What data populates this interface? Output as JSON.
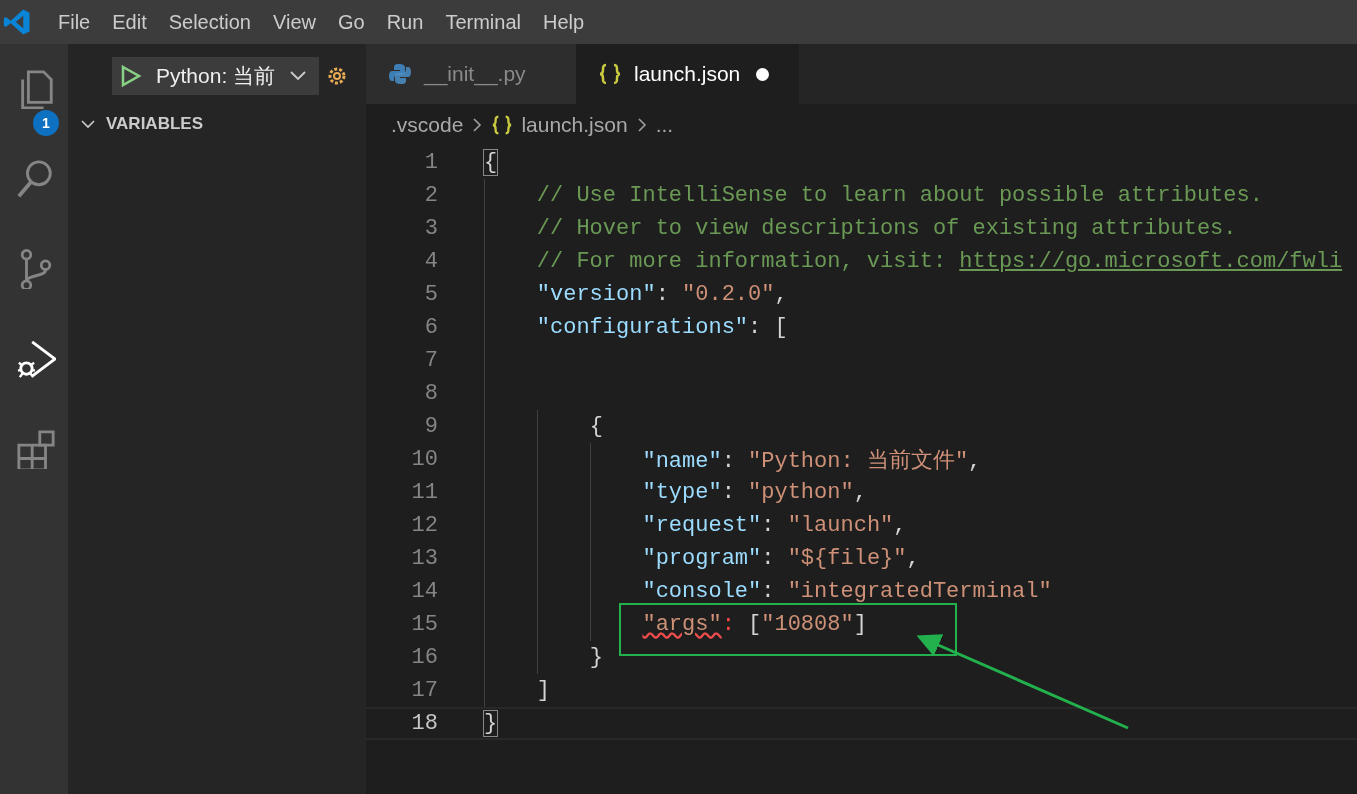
{
  "menu": [
    "File",
    "Edit",
    "Selection",
    "View",
    "Go",
    "Run",
    "Terminal",
    "Help"
  ],
  "activity_bar": [
    {
      "kind": "files",
      "selected": false,
      "badge": "1"
    },
    {
      "kind": "search",
      "selected": false
    },
    {
      "kind": "source-control",
      "selected": false
    },
    {
      "kind": "debug",
      "selected": true
    },
    {
      "kind": "extensions",
      "selected": false
    }
  ],
  "sidebar": {
    "run_config": "Python: 当前",
    "section": {
      "title": "VARIABLES",
      "expanded": true
    }
  },
  "tabs": [
    {
      "label": "__init__.py",
      "kind": "python",
      "selected": false,
      "modified": false
    },
    {
      "label": "launch.json",
      "kind": "json",
      "selected": true,
      "modified": true
    }
  ],
  "breadcrumb": [
    {
      "text": ".vscode",
      "kind": "folder"
    },
    {
      "text": "launch.json",
      "kind": "json"
    },
    {
      "text": "...",
      "kind": "more"
    }
  ],
  "code": [
    {
      "number": "1",
      "selected": false,
      "tokens": [
        {
          "kind": "bracket",
          "text": "{"
        }
      ]
    },
    {
      "number": "2",
      "selected": false,
      "tokens": [
        {
          "kind": "comment",
          "text": "    // Use IntelliSense to learn about possible attributes."
        }
      ]
    },
    {
      "number": "3",
      "selected": false,
      "tokens": [
        {
          "kind": "comment",
          "text": "    // Hover to view descriptions of existing attributes."
        }
      ]
    },
    {
      "number": "4",
      "selected": false,
      "tokens": [
        {
          "kind": "comment",
          "text": "    // For more information, visit: "
        },
        {
          "kind": "link",
          "text": "https://go.microsoft.com/fwli"
        }
      ]
    },
    {
      "number": "5",
      "selected": false,
      "tokens": [
        {
          "kind": "key",
          "text": "    \"version\""
        },
        {
          "kind": "punct",
          "text": ": "
        },
        {
          "kind": "string",
          "text": "\"0.2.0\""
        },
        {
          "kind": "punct",
          "text": ","
        }
      ]
    },
    {
      "number": "6",
      "selected": false,
      "tokens": [
        {
          "kind": "key",
          "text": "    \"configurations\""
        },
        {
          "kind": "punct",
          "text": ": ["
        }
      ]
    },
    {
      "number": "7",
      "selected": false
    },
    {
      "number": "8",
      "selected": false
    },
    {
      "number": "9",
      "selected": false,
      "tokens": [
        {
          "kind": "punct",
          "text": "        {"
        }
      ]
    },
    {
      "number": "10",
      "selected": false,
      "tokens": [
        {
          "kind": "key",
          "text": "            \"name\""
        },
        {
          "kind": "punct",
          "text": ": "
        },
        {
          "kind": "string",
          "text": "\"Python: 当前文件\""
        },
        {
          "kind": "punct",
          "text": ","
        }
      ]
    },
    {
      "number": "11",
      "selected": false,
      "tokens": [
        {
          "kind": "key",
          "text": "            \"type\""
        },
        {
          "kind": "punct",
          "text": ": "
        },
        {
          "kind": "string",
          "text": "\"python\""
        },
        {
          "kind": "punct",
          "text": ","
        }
      ]
    },
    {
      "number": "12",
      "selected": false,
      "tokens": [
        {
          "kind": "key",
          "text": "            \"request\""
        },
        {
          "kind": "punct",
          "text": ": "
        },
        {
          "kind": "string",
          "text": "\"launch\""
        },
        {
          "kind": "punct",
          "text": ","
        }
      ]
    },
    {
      "number": "13",
      "selected": false,
      "tokens": [
        {
          "kind": "key",
          "text": "            \"program\""
        },
        {
          "kind": "punct",
          "text": ": "
        },
        {
          "kind": "string",
          "text": "\"${file}\""
        },
        {
          "kind": "punct",
          "text": ","
        }
      ]
    },
    {
      "number": "14",
      "selected": false,
      "tokens": [
        {
          "kind": "key",
          "text": "            \"console\""
        },
        {
          "kind": "punct",
          "text": ": "
        },
        {
          "kind": "string",
          "text": "\"integratedTerminal\""
        }
      ]
    },
    {
      "number": "15",
      "selected": false,
      "tokens": [
        {
          "kind": "error-key",
          "text": "            \"args\""
        },
        {
          "kind": "error-punct",
          "text": ":"
        },
        {
          "kind": "punct",
          "text": " ["
        },
        {
          "kind": "string",
          "text": "\"10808\""
        },
        {
          "kind": "punct",
          "text": "]"
        }
      ]
    },
    {
      "number": "16",
      "selected": false,
      "tokens": [
        {
          "kind": "punct",
          "text": "        }"
        }
      ]
    },
    {
      "number": "17",
      "selected": false,
      "tokens": [
        {
          "kind": "punct",
          "text": "    ]"
        }
      ]
    },
    {
      "number": "18",
      "selected": true,
      "tokens": [
        {
          "kind": "bracket",
          "text": "}"
        }
      ]
    }
  ]
}
